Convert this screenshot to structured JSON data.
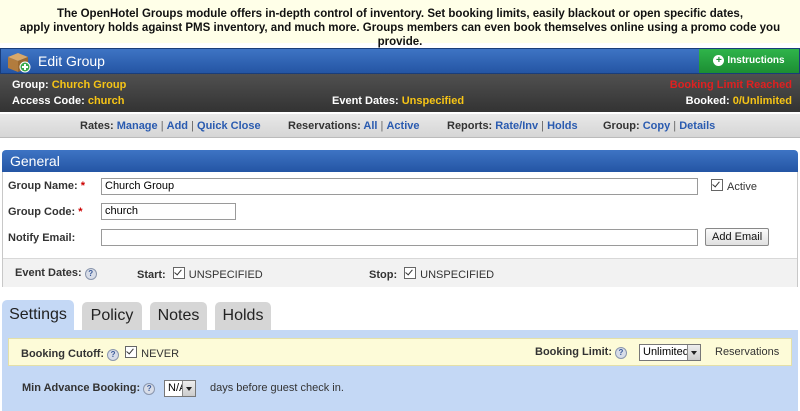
{
  "banner": {
    "line1": "The OpenHotel Groups module offers in-depth control of inventory. Set booking limits, easily blackout or open specific dates,",
    "line2": "apply inventory holds against PMS inventory, and much more. Groups members can even book themselves online using a promo code you provide."
  },
  "header": {
    "title": "Edit Group",
    "instructions_label": "Instructions"
  },
  "info": {
    "group_label": "Group:",
    "group_value": "Church Group",
    "access_label": "Access Code:",
    "access_value": "church",
    "event_dates_label": "Event Dates:",
    "event_dates_value": "Unspecified",
    "limit_status": "Booking Limit Reached",
    "booked_label": "Booked:",
    "booked_value": "0/Unlimited"
  },
  "linkbar": {
    "rates_label": "Rates:",
    "rates_manage": "Manage",
    "rates_add": "Add",
    "rates_quick_close": "Quick Close",
    "reservations_label": "Reservations:",
    "res_all": "All",
    "res_active": "Active",
    "reports_label": "Reports:",
    "rep_rate_inv": "Rate/Inv",
    "rep_holds": "Holds",
    "group_label": "Group:",
    "grp_copy": "Copy",
    "grp_details": "Details"
  },
  "general": {
    "heading": "General",
    "group_name_label": "Group Name:",
    "group_name_value": "Church Group",
    "active_label": "Active",
    "group_code_label": "Group Code:",
    "group_code_value": "church",
    "notify_email_label": "Notify Email:",
    "notify_email_value": "",
    "add_email_label": "Add Email",
    "event_dates_label": "Event Dates:",
    "start_label": "Start:",
    "start_value": "UNSPECIFIED",
    "stop_label": "Stop:",
    "stop_value": "UNSPECIFIED"
  },
  "tabs": [
    "Settings",
    "Policy",
    "Notes",
    "Holds"
  ],
  "settings": {
    "booking_cutoff_label": "Booking Cutoff:",
    "booking_cutoff_value": "NEVER",
    "booking_limit_label": "Booking Limit:",
    "booking_limit_value": "Unlimited",
    "reservations_label": "Reservations",
    "min_advance_label": "Min Advance Booking:",
    "min_advance_value": "N/A",
    "min_advance_suffix": "days before guest check in."
  },
  "colors": {
    "header_blue": "#2f62b3",
    "accent_yellow": "#f6c416",
    "alert_red": "#e02020",
    "instructions_green": "#24a23e",
    "link_blue": "#2a5bb0",
    "tab_panel_blue": "#c4d8f5"
  }
}
